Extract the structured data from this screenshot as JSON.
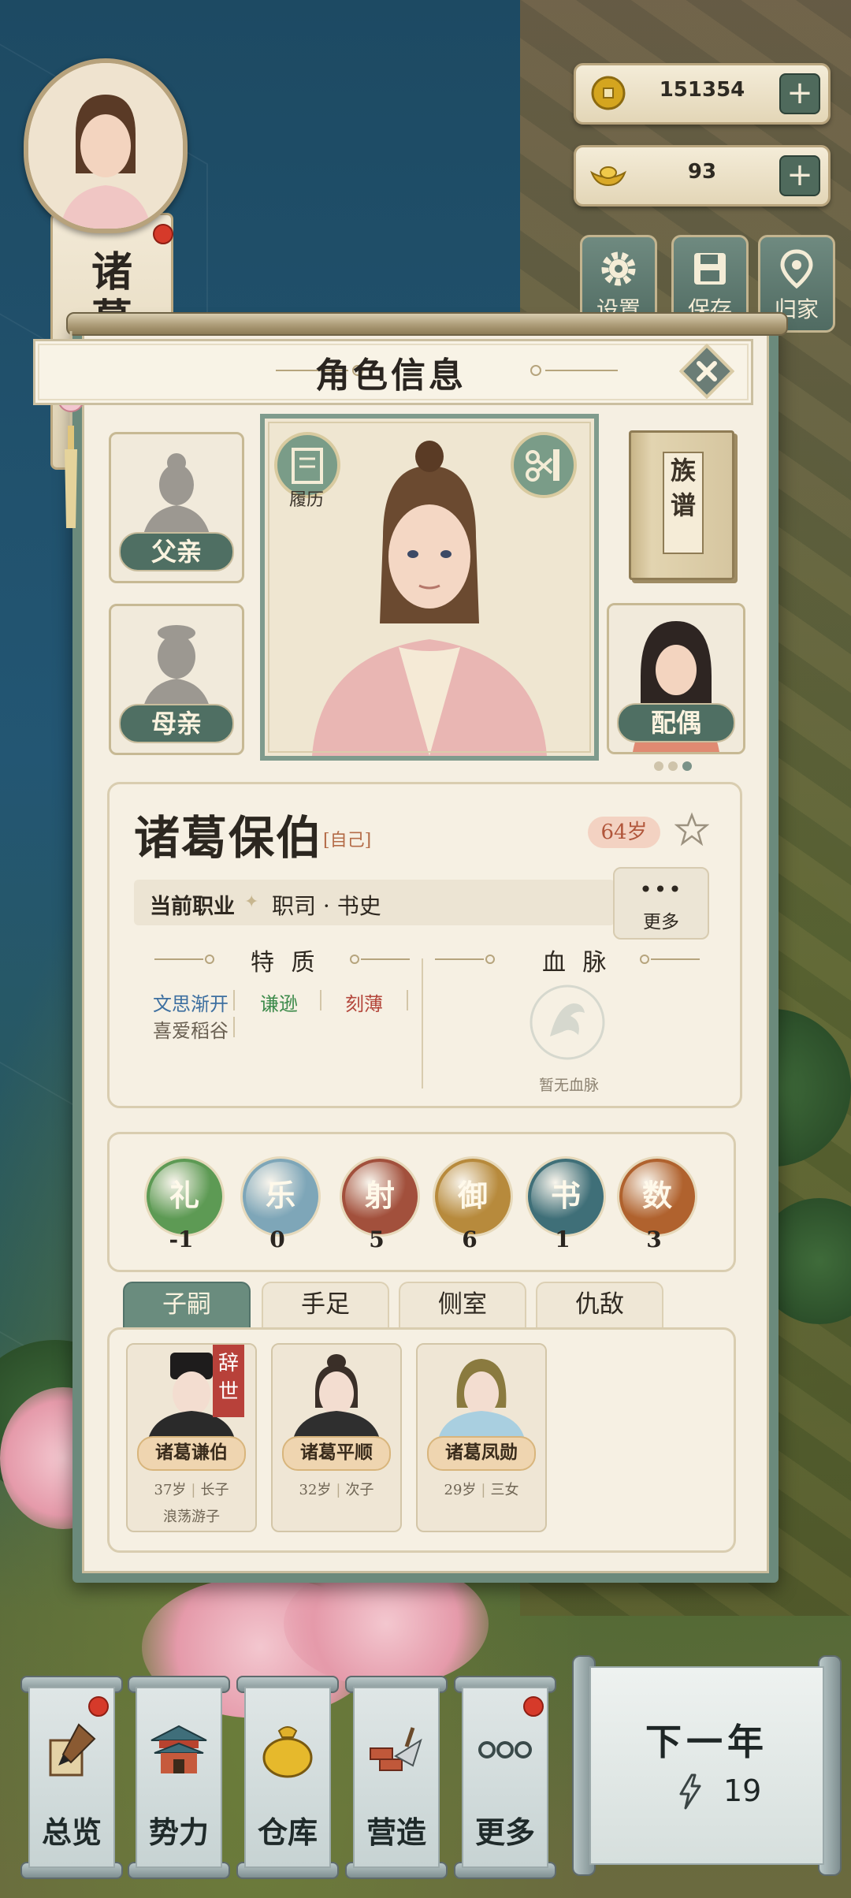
{
  "hud": {
    "coins": "151354",
    "ingots": "93",
    "buttons": [
      {
        "label": "设置",
        "icon": "gear-icon"
      },
      {
        "label": "保存",
        "icon": "save-icon"
      },
      {
        "label": "归家",
        "icon": "home-pin-icon"
      }
    ]
  },
  "side_scroll": {
    "chars": [
      "诸",
      "葛"
    ]
  },
  "panel": {
    "title": "角色信息",
    "father_label": "父亲",
    "mother_label": "母亲",
    "spouse_label": "配偶",
    "resume_label": "履历",
    "genealogy_chars": [
      "族",
      "谱"
    ],
    "page_dots": 3,
    "page_dot_active": 3
  },
  "character": {
    "name": "诸葛保伯",
    "tag": "[自己]",
    "age": "64岁",
    "job_label": "当前职业",
    "job_value": "职司 · 书史",
    "more_dots": "•••",
    "more_label": "更多",
    "traits_heading": "特 质",
    "bloodline_heading": "血 脉",
    "traits": [
      {
        "text": "文思渐开",
        "color": "#3d6fa0"
      },
      {
        "text": "谦逊",
        "color": "#3c8a4a"
      },
      {
        "text": "刻薄",
        "color": "#b4473c"
      },
      {
        "text": "喜爱稻谷",
        "color": "#6a6052"
      }
    ],
    "bloodline_none": "暂无血脉"
  },
  "six_arts": [
    {
      "name": "礼",
      "value": "-1",
      "color": "#5d9a54"
    },
    {
      "name": "乐",
      "value": "0",
      "color": "#7ea6b8"
    },
    {
      "name": "射",
      "value": "5",
      "color": "#a2503c"
    },
    {
      "name": "御",
      "value": "6",
      "color": "#b78a3c"
    },
    {
      "name": "书",
      "value": "1",
      "color": "#3f6f78"
    },
    {
      "name": "数",
      "value": "3",
      "color": "#b0622e"
    }
  ],
  "tabs": [
    "子嗣",
    "手足",
    "侧室",
    "仇敌"
  ],
  "children": [
    {
      "name": "诸葛谦伯",
      "age": "37岁",
      "rank": "长子",
      "extra": "浪荡游子",
      "deceased": "辞世"
    },
    {
      "name": "诸葛平顺",
      "age": "32岁",
      "rank": "次子",
      "extra": "",
      "deceased": ""
    },
    {
      "name": "诸葛凤勋",
      "age": "29岁",
      "rank": "三女",
      "extra": "",
      "deceased": ""
    }
  ],
  "bottom_nav": [
    {
      "label": "总览",
      "icon": "brush-scroll-icon",
      "badge": true
    },
    {
      "label": "势力",
      "icon": "palace-icon",
      "badge": false
    },
    {
      "label": "仓库",
      "icon": "money-bag-icon",
      "badge": false
    },
    {
      "label": "营造",
      "icon": "trowel-bricks-icon",
      "badge": false
    },
    {
      "label": "更多",
      "icon": "more-icon",
      "badge": true
    }
  ],
  "next_year": {
    "label": "下一年",
    "energy": "19"
  }
}
